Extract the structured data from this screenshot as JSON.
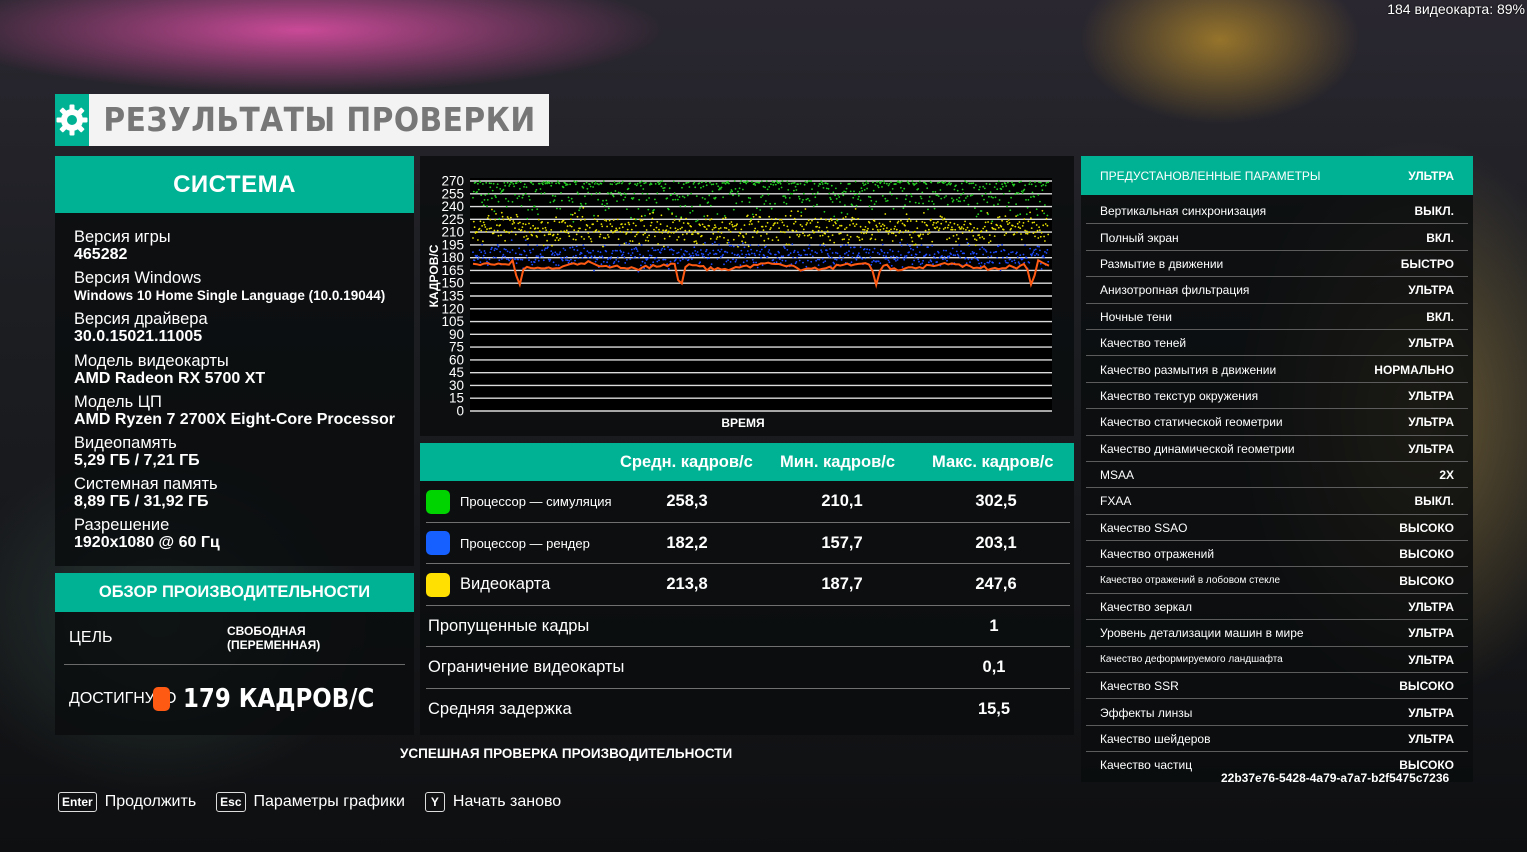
{
  "overlay": {
    "fps_text": "184 видеокарта: 89%"
  },
  "title": {
    "text": "РЕЗУЛЬТАТЫ ПРОВЕРКИ",
    "icon": "gear-icon"
  },
  "system": {
    "heading": "СИСТЕМА",
    "items": [
      {
        "label": "Версия игры",
        "value": "465282"
      },
      {
        "label": "Версия Windows",
        "value": "Windows 10 Home Single Language (10.0.19044)"
      },
      {
        "label": "Версия драйвера",
        "value": "30.0.15021.11005"
      },
      {
        "label": "Модель видеокарты",
        "value": "AMD Radeon RX 5700 XT"
      },
      {
        "label": "Модель ЦП",
        "value": "AMD Ryzen 7 2700X Eight-Core Processor"
      },
      {
        "label": "Видеопамять",
        "value": "5,29 ГБ / 7,21 ГБ"
      },
      {
        "label": "Системная память",
        "value": "8,89 ГБ / 31,92 ГБ"
      },
      {
        "label": "Разрешение",
        "value": "1920x1080 @ 60 Гц"
      }
    ]
  },
  "performance": {
    "heading": "ОБЗОР ПРОИЗВОДИТЕЛЬНОСТИ",
    "target_label": "ЦЕЛЬ",
    "target_value": "СВОБОДНАЯ (ПЕРЕМЕННАЯ)",
    "achieved_label": "ДОСТИГНУТО",
    "achieved_value": "179 КАДРОВ/С",
    "achieved_color": "#ff5a14"
  },
  "chart_data": {
    "type": "scatter",
    "ylabel": "КАДРОВ/С",
    "xlabel": "ВРЕМЯ",
    "ylim": [
      0,
      270
    ],
    "yticks": [
      0,
      15,
      30,
      45,
      60,
      75,
      90,
      105,
      120,
      135,
      150,
      165,
      180,
      195,
      210,
      225,
      240,
      255,
      270
    ],
    "series": [
      {
        "name": "Процессор — симуляция",
        "color": "#22d022",
        "mean": 258.3,
        "min": 210.1,
        "max": 302.5,
        "kind": "scatter"
      },
      {
        "name": "Видеокарта",
        "color": "#e8e000",
        "mean": 213.8,
        "min": 187.7,
        "max": 247.6,
        "kind": "scatter"
      },
      {
        "name": "Процессор — рендер",
        "color": "#1e4bff",
        "mean": 182.2,
        "min": 157.7,
        "max": 203.1,
        "kind": "scatter"
      },
      {
        "name": "ДОСТИГНУТО",
        "color": "#ff5a14",
        "mean": 179,
        "kind": "line",
        "dips": [
          [
            0.08,
            145
          ],
          [
            0.36,
            142
          ],
          [
            0.7,
            148
          ],
          [
            0.97,
            145
          ]
        ]
      }
    ]
  },
  "fps_table": {
    "headers": [
      "Средн. кадров/с",
      "Мин. кадров/с",
      "Макс. кадров/с"
    ],
    "rows": [
      {
        "name": "Процессор — симуляция",
        "color": "#00d400",
        "avg": "258,3",
        "min": "210,1",
        "max": "302,5"
      },
      {
        "name": "Процессор — рендер",
        "color": "#1560ff",
        "avg": "182,2",
        "min": "157,7",
        "max": "203,1"
      },
      {
        "name": "Видеокарта",
        "color": "#ffe000",
        "avg": "213,8",
        "min": "187,7",
        "max": "247,6"
      }
    ],
    "extra": [
      {
        "name": "Пропущенные кадры",
        "value": "1"
      },
      {
        "name": "Ограничение видеокарты",
        "value": "0,1"
      },
      {
        "name": "Средняя задержка",
        "value": "15,5"
      }
    ]
  },
  "status": {
    "text": "УСПЕШНАЯ ПРОВЕРКА ПРОИЗВОДИТЕЛЬНОСТИ"
  },
  "settings": {
    "preset_label": "ПРЕДУСТАНОВЛЕННЫЕ ПАРАМЕТРЫ",
    "preset_value": "УЛЬТРА",
    "items": [
      {
        "name": "Вертикальная синхронизация",
        "value": "ВЫКЛ."
      },
      {
        "name": "Полный экран",
        "value": "ВКЛ."
      },
      {
        "name": "Размытие в движении",
        "value": "БЫСТРО"
      },
      {
        "name": "Анизотропная фильтрация",
        "value": "УЛЬТРА"
      },
      {
        "name": "Ночные тени",
        "value": "ВКЛ."
      },
      {
        "name": "Качество теней",
        "value": "УЛЬТРА"
      },
      {
        "name": "Качество размытия в движении",
        "value": "НОРМАЛЬНО"
      },
      {
        "name": "Качество текстур окружения",
        "value": "УЛЬТРА"
      },
      {
        "name": "Качество статической геометрии",
        "value": "УЛЬТРА"
      },
      {
        "name": "Качество динамической геометрии",
        "value": "УЛЬТРА"
      },
      {
        "name": "MSAA",
        "value": "2X"
      },
      {
        "name": "FXAA",
        "value": "ВЫКЛ."
      },
      {
        "name": "Качество SSAO",
        "value": "ВЫСОКО"
      },
      {
        "name": "Качество отражений",
        "value": "ВЫСОКО"
      },
      {
        "name": "Качество отражений в лобовом стекле",
        "value": "ВЫСОКО"
      },
      {
        "name": "Качество зеркал",
        "value": "УЛЬТРА"
      },
      {
        "name": "Уровень детализации машин в мире",
        "value": "УЛЬТРА"
      },
      {
        "name": "Качество деформируемого ландшафта",
        "value": "УЛЬТРА"
      },
      {
        "name": "Качество SSR",
        "value": "ВЫСОКО"
      },
      {
        "name": "Эффекты линзы",
        "value": "УЛЬТРА"
      },
      {
        "name": "Качество шейдеров",
        "value": "УЛЬТРА"
      },
      {
        "name": "Качество частиц",
        "value": "ВЫСОКО"
      }
    ],
    "guid": "22b37e76-5428-4a79-a7a7-b2f5475c7236"
  },
  "keys": [
    {
      "cap": "Enter",
      "label": "Продолжить"
    },
    {
      "cap": "Esc",
      "label": "Параметры графики"
    },
    {
      "cap": "Y",
      "label": "Начать заново"
    }
  ]
}
